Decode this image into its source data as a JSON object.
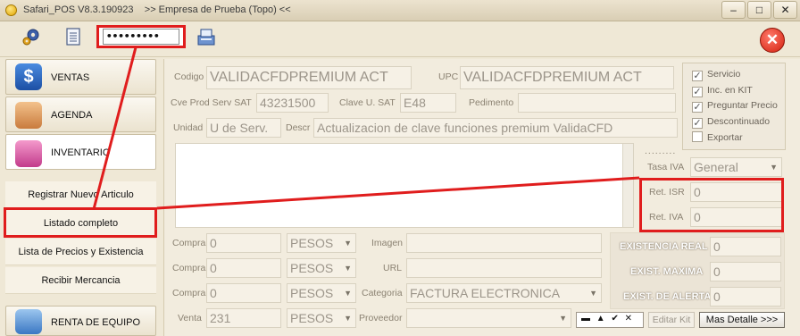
{
  "window": {
    "title": "Safari_POS V8.3.190923",
    "company": ">> Empresa de Prueba (Topo) <<",
    "min_symbol": "–",
    "max_symbol": "□",
    "close_symbol": "✕"
  },
  "toolbar": {
    "password_value": "•••••••••",
    "exit_symbol": "✕"
  },
  "sidebar": {
    "ventas": "VENTAS",
    "ventas_glyph": "$",
    "agenda": "AGENDA",
    "inventario": "INVENTARIO",
    "renta": "RENTA DE EQUIPO",
    "sub_items": {
      "registrar": "Registrar Nuevo Articulo",
      "listado": "Listado completo",
      "lista_precios": "Lista de Precios y Existencia",
      "recibir": "Recibir Mercancia"
    }
  },
  "form": {
    "codigo_label": "Codigo",
    "codigo_value": "VALIDACFDPREMIUM ACT",
    "upc_label": "UPC",
    "upc_value": "VALIDACFDPREMIUM ACT",
    "cve_prod_label": "Cve Prod Serv SAT",
    "cve_prod_value": "43231500",
    "clave_u_label": "Clave U. SAT",
    "clave_u_value": "E48",
    "pedimento_label": "Pedimento",
    "pedimento_value": "",
    "unidad_label": "Unidad",
    "unidad_value": "U de Serv.",
    "descr_label": "Descr",
    "descr_value": "Actualizacion de clave funciones premium ValidaCFD",
    "compra_label": "Compra",
    "venta_label": "Venta",
    "prices": [
      {
        "label": "Compra",
        "value": "0",
        "currency": "PESOS"
      },
      {
        "label": "Compra",
        "value": "0",
        "currency": "PESOS"
      },
      {
        "label": "Compra",
        "value": "0",
        "currency": "PESOS"
      },
      {
        "label": "Venta",
        "value": "231",
        "currency": "PESOS"
      }
    ],
    "imagen_label": "Imagen",
    "url_label": "URL",
    "categoria_label": "Categoria",
    "categoria_value": "FACTURA ELECTRONICA",
    "proveedor_label": "Proveedor",
    "proveedor_value": "",
    "dots": ".........",
    "tasa_iva_label": "Tasa IVA",
    "tasa_iva_value": "General",
    "ret_isr_label": "Ret. ISR",
    "ret_isr_value": "0",
    "ret_iva_label": "Ret. IVA",
    "ret_iva_value": "0"
  },
  "checkboxes": [
    {
      "label": "Servicio",
      "checked": true
    },
    {
      "label": "Inc. en KIT",
      "checked": true
    },
    {
      "label": "Preguntar Precio",
      "checked": true
    },
    {
      "label": "Descontinuado",
      "checked": true
    },
    {
      "label": "Exportar",
      "checked": false
    }
  ],
  "existencias": {
    "real_label": "EXISTENCIA REAL",
    "real_value": "0",
    "maxima_label": "EXIST. MAXIMA",
    "maxima_value": "0",
    "alerta_label": "EXIST. DE ALERTA",
    "alerta_value": "0"
  },
  "bottom": {
    "mini_tools": "▬ ▲ ✔ ✕",
    "editar_kit": "Editar Kit",
    "mas_detalle": "Mas Detalle >>>"
  },
  "colors": {
    "annotation_red": "#e01d1d",
    "panel_bg": "#f2ecde",
    "window_bg": "#efe8d6"
  }
}
